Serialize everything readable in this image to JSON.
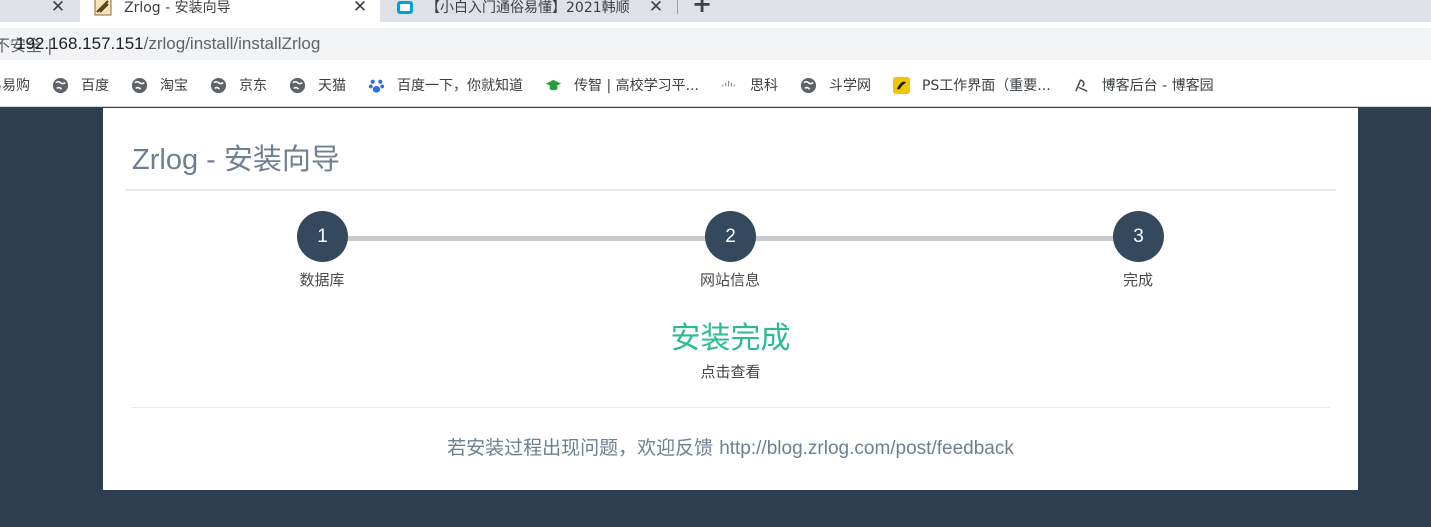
{
  "browser": {
    "tabs": [
      {
        "title": "",
        "icon": "page-icon"
      },
      {
        "title": "Zrlog - 安装向导",
        "icon": "zrlog-favicon-icon",
        "active": true
      },
      {
        "title": "【小白入门通俗易懂】2021韩顺",
        "icon": "bilibili-tv-icon"
      }
    ],
    "new_tab_label": "+",
    "address_prefix": "不安全 |",
    "url_host": "192.168.157.151",
    "url_path": "/zrlog/install/installZrlog",
    "bookmarks": [
      {
        "label": "网易易购",
        "icon": "none"
      },
      {
        "label": "百度",
        "icon": "globe-icon"
      },
      {
        "label": "淘宝",
        "icon": "globe-icon"
      },
      {
        "label": "京东",
        "icon": "globe-icon"
      },
      {
        "label": "天猫",
        "icon": "globe-icon"
      },
      {
        "label": "百度一下，你就知道",
        "icon": "baidu-paw-icon"
      },
      {
        "label": "传智 | 高校学习平...",
        "icon": "mortarboard-icon"
      },
      {
        "label": "思科",
        "icon": "cisco-icon"
      },
      {
        "label": "斗学网",
        "icon": "globe-icon"
      },
      {
        "label": "PS工作界面（重要...",
        "icon": "ps-icon"
      },
      {
        "label": "博客后台 - 博客园",
        "icon": "cnblogs-icon"
      }
    ]
  },
  "page": {
    "title": "Zrlog - 安装向导",
    "steps": [
      {
        "number": "1",
        "label": "数据库"
      },
      {
        "number": "2",
        "label": "网站信息"
      },
      {
        "number": "3",
        "label": "完成"
      }
    ],
    "done_title": "安装完成",
    "done_link": "点击查看",
    "feedback_text": "若安装过程出现问题，欢迎反馈 ",
    "feedback_link": "http://blog.zrlog.com/post/feedback"
  },
  "colors": {
    "page_background": "#2c3e50",
    "step_circle": "#34495e",
    "success_green": "#2bbb94",
    "muted_text": "#6f7f92"
  }
}
